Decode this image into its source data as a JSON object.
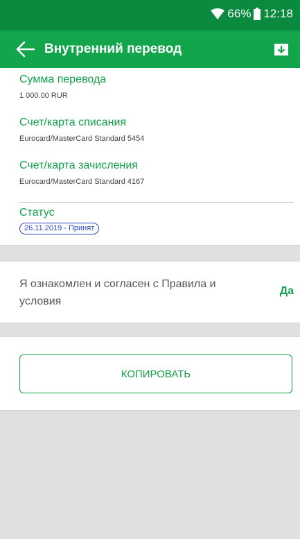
{
  "status_bar": {
    "battery": "66%",
    "time": "12:18",
    "icons": [
      "wifi-icon",
      "battery-icon"
    ]
  },
  "toolbar": {
    "title": "Внутренний перевод",
    "back_icon": "arrow-left-icon",
    "action_icon": "download-icon"
  },
  "details": {
    "amount_label": "Сумма перевода",
    "amount_value": "1 000.00 RUR",
    "source_label": "Счет/карта списания",
    "source_value": "Eurocard/MasterCard Standard 5454",
    "target_label": "Счет/карта зачисления",
    "target_value": "Eurocard/MasterCard Standard 4167",
    "status_label": "Статус",
    "status_value": "26.11.2019 - Принят"
  },
  "agreement": {
    "text": "Я ознакомлен и согласен с Правила и условия",
    "value": "Да"
  },
  "actions": {
    "copy_label": "КОПИРОВАТЬ"
  },
  "colors": {
    "status_bar": "#0a8a3e",
    "toolbar": "#12a54b",
    "accent_green": "#12a04a",
    "status_blue": "#2a45c8",
    "background": "#e0e0e0"
  }
}
